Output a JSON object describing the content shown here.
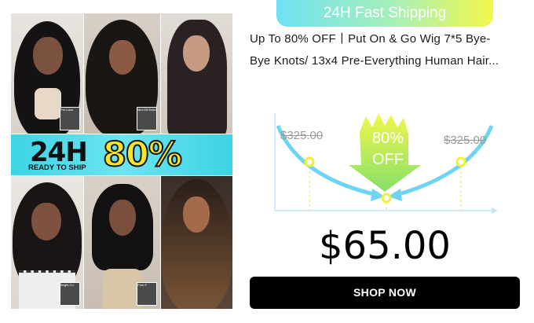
{
  "shipping_pill": "24H Fast Shipping",
  "title_line1": "Up To 80% OFF丨Put On & Go Wig 7*5 Bye-",
  "title_line2": "Bye Knots/ 13x4 Pre-Everything Human Hair...",
  "banner": {
    "hours": "24H",
    "ready": "READY TO SHIP",
    "discount": "80% OFF"
  },
  "tags": {
    "p1": "Pre-Lace",
    "p2": "Mini Elf Braid",
    "p4": "Bright Cu",
    "p5": "Free P"
  },
  "chart": {
    "old_price_left": "$325.00",
    "old_price_right": "$325.00",
    "badge_pct": "80%",
    "badge_off": "OFF"
  },
  "price": "$65.00",
  "cta": "SHOP NOW",
  "colors": {
    "accent_cyan": "#6fd3f2",
    "badge_green": "#8fe36b",
    "badge_yellow": "#f2f74a",
    "cta_bg": "#000000"
  }
}
